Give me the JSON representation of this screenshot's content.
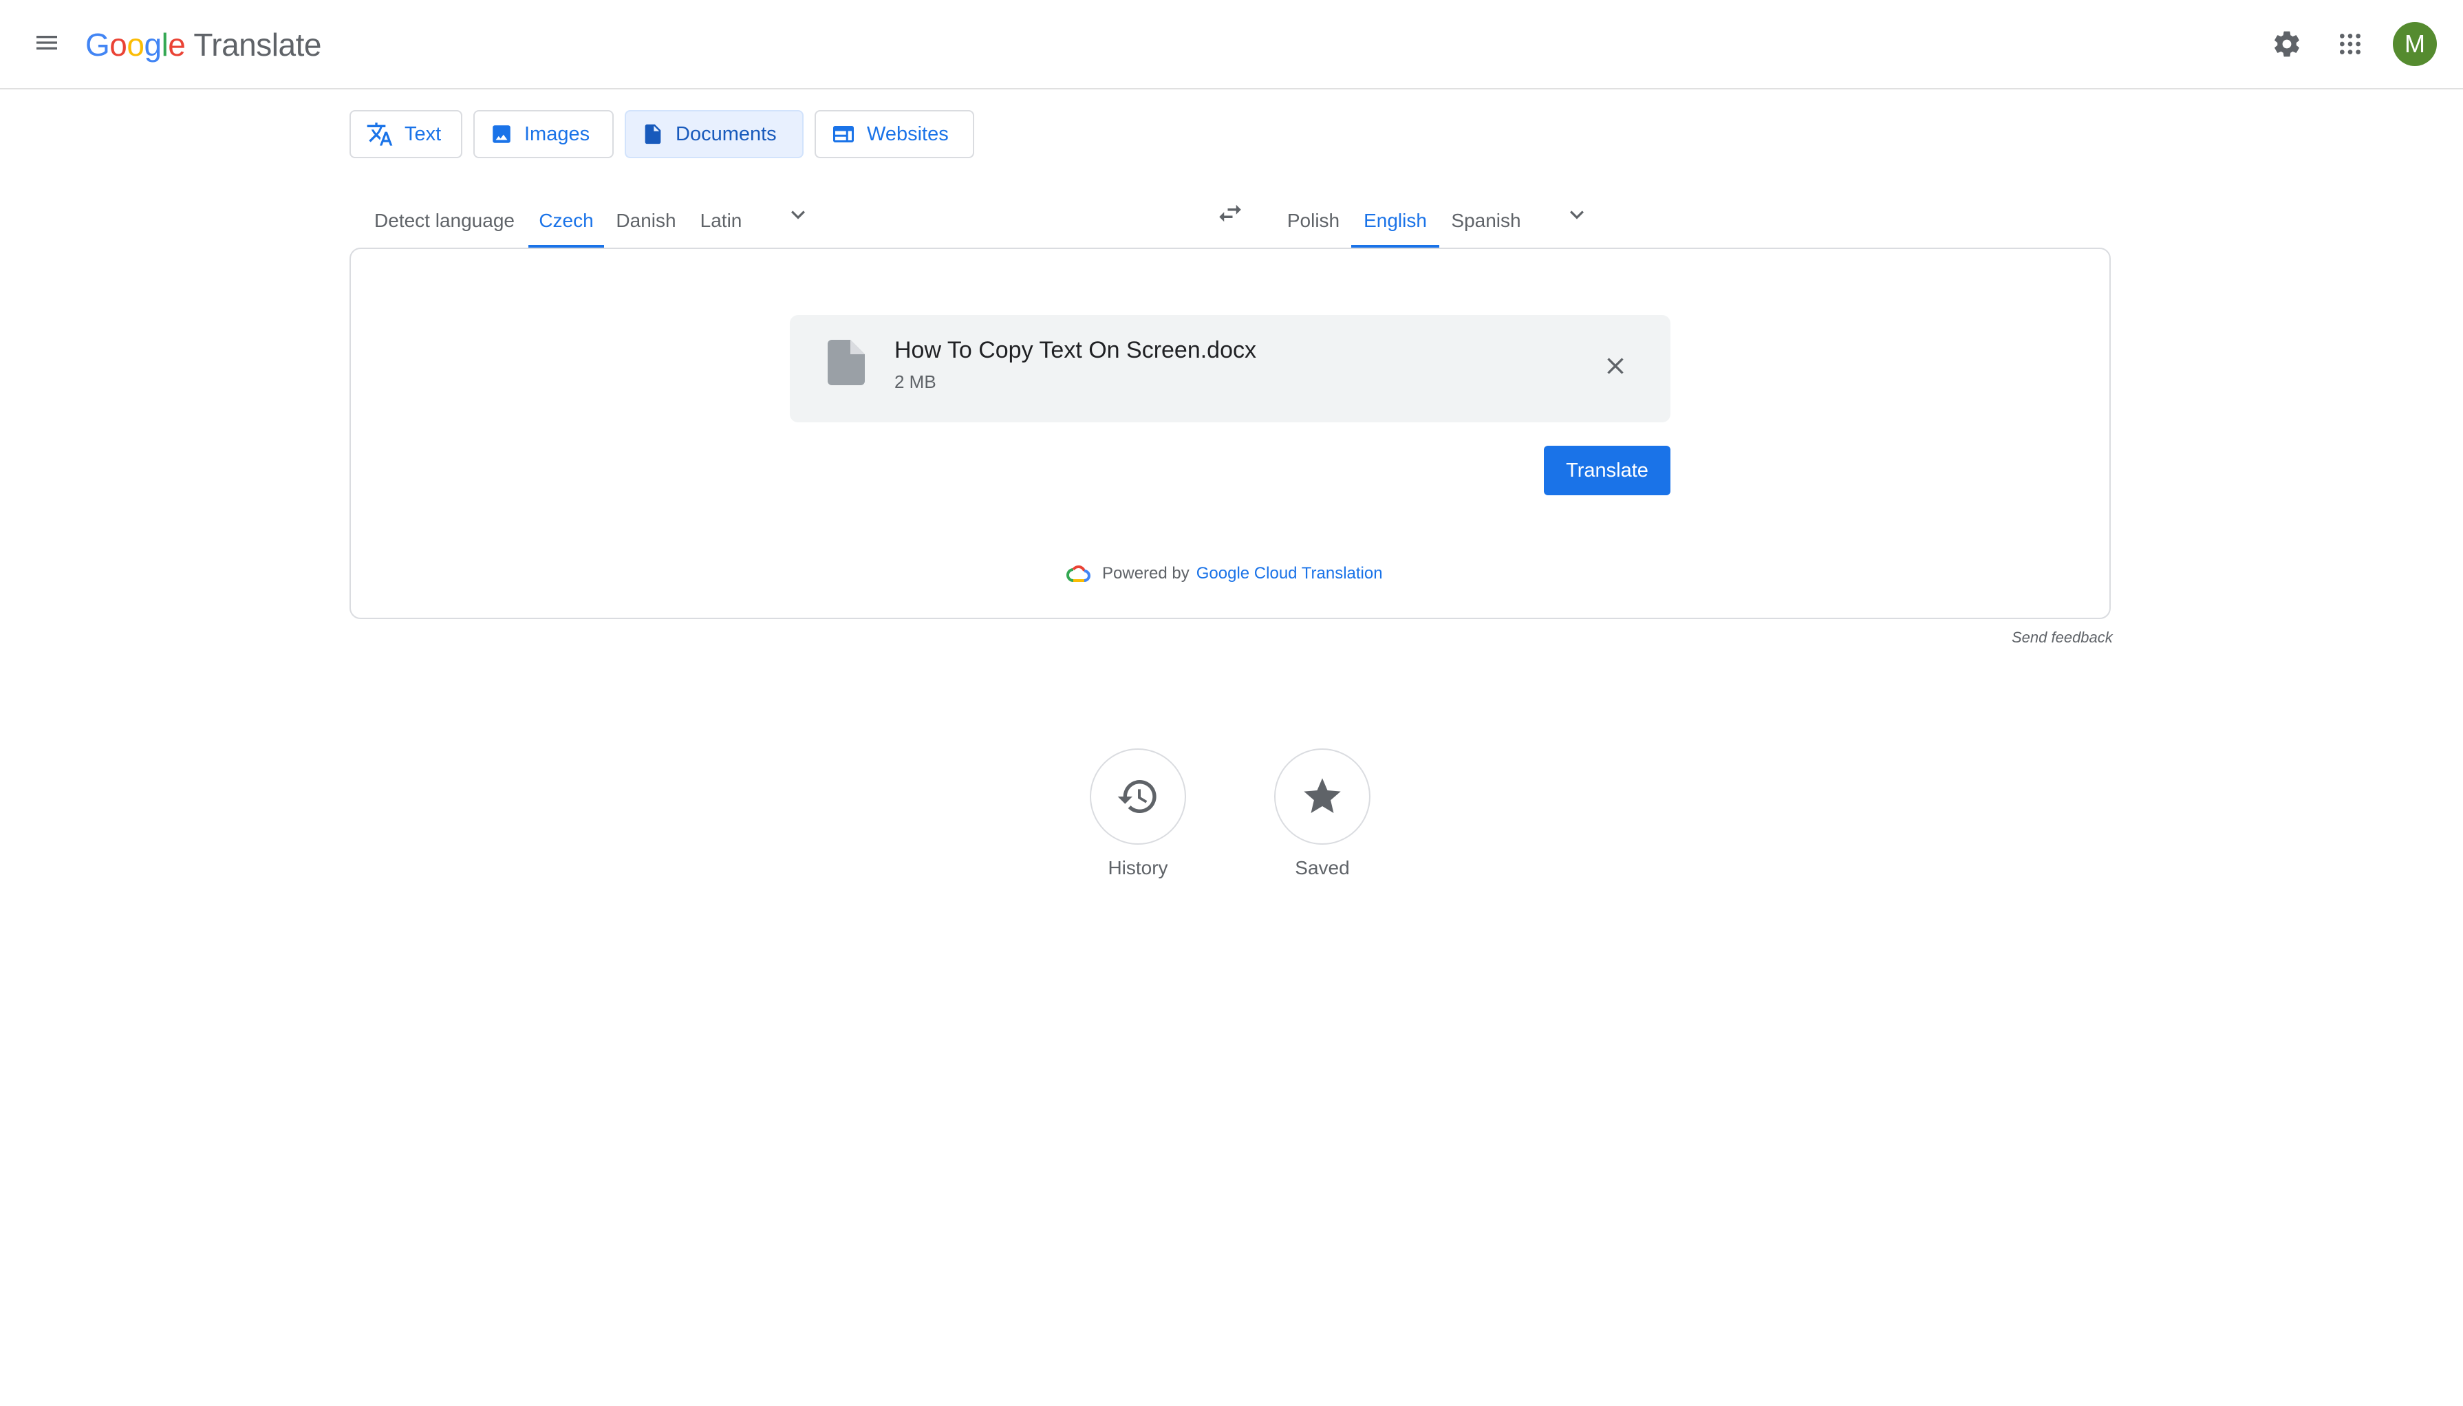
{
  "header": {
    "logo": {
      "google": "Google",
      "product": "Translate"
    },
    "avatar_initial": "M",
    "icons": {
      "menu": "menu-icon",
      "settings": "gear-icon",
      "apps": "apps-grid-icon"
    }
  },
  "modes": [
    {
      "label": "Text",
      "icon": "translate-icon",
      "active": false
    },
    {
      "label": "Images",
      "icon": "image-icon",
      "active": false
    },
    {
      "label": "Documents",
      "icon": "document-icon",
      "active": true
    },
    {
      "label": "Websites",
      "icon": "web-icon",
      "active": false
    }
  ],
  "source_languages": {
    "items": [
      "Detect language",
      "Czech",
      "Danish",
      "Latin"
    ],
    "selected": "Czech"
  },
  "target_languages": {
    "items": [
      "Polish",
      "English",
      "Spanish"
    ],
    "selected": "English"
  },
  "document": {
    "file_name": "How To Copy Text On Screen.docx",
    "file_size": "2 MB",
    "translate_label": "Translate"
  },
  "powered_by": {
    "prefix": "Powered by",
    "link": "Google Cloud Translation"
  },
  "feedback_label": "Send feedback",
  "bottom_actions": [
    {
      "label": "History",
      "icon": "history-icon"
    },
    {
      "label": "Saved",
      "icon": "star-icon"
    }
  ],
  "colors": {
    "accent": "#1a73e8",
    "avatar_bg": "#558b2f",
    "active_tab_bg": "#e8f0fe",
    "file_card_bg": "#f1f3f4"
  }
}
